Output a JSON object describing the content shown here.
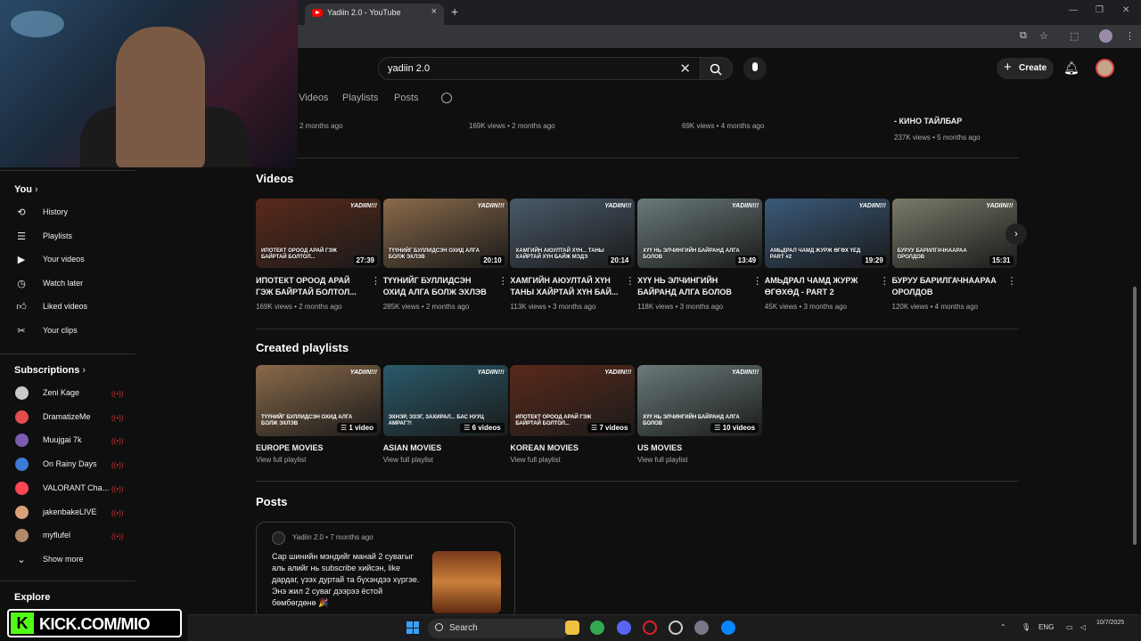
{
  "browser": {
    "tab_title": "Yadiin 2.0 - YouTube",
    "tab_close": "×",
    "new_tab": "+"
  },
  "header": {
    "search_value": "yadiin 2.0",
    "create_label": "Create"
  },
  "channel_tabs": [
    "Videos",
    "Playlists",
    "Posts"
  ],
  "sidebar": {
    "you_label": "You",
    "you_items": [
      {
        "label": "History",
        "icon": "history-icon"
      },
      {
        "label": "Playlists",
        "icon": "playlists-icon"
      },
      {
        "label": "Your videos",
        "icon": "your-videos-icon"
      },
      {
        "label": "Watch later",
        "icon": "watch-later-icon"
      },
      {
        "label": "Liked videos",
        "icon": "thumbs-up-icon"
      },
      {
        "label": "Your clips",
        "icon": "scissors-icon"
      }
    ],
    "subs_label": "Subscriptions",
    "subscriptions": [
      {
        "label": "Zeni Kage",
        "color": "#c9c9c9"
      },
      {
        "label": "DramatizeMe",
        "color": "#e44d4d"
      },
      {
        "label": "Muujgai 7k",
        "color": "#7a5cb0"
      },
      {
        "label": "On Rainy Days",
        "color": "#3a7bd5"
      },
      {
        "label": "VALORANT Cha...",
        "color": "#ff4655"
      },
      {
        "label": "jakenbakeLIVE",
        "color": "#d9a07a"
      },
      {
        "label": "myflufel",
        "color": "#b08b6a"
      }
    ],
    "show_more": "Show more",
    "explore_label": "Explore"
  },
  "top_row": {
    "items": [
      {
        "meta": "2 months ago"
      },
      {
        "meta": "169K views • 2 months ago"
      },
      {
        "meta": "69K views • 4 months ago"
      },
      {
        "title": "- КИНО ТАЙЛБАР",
        "meta": "237K views • 5 months ago"
      }
    ]
  },
  "videos_section": {
    "title": "Videos",
    "videos": [
      {
        "title": "ИПОТЕКТ ОРООД АРАЙ ГЭЖ БАЙРТАЙ БОЛТОЛ...",
        "meta": "169K views • 2 months ago",
        "duration": "27:39",
        "thumb_caption": "ИПОТЕКТ ОРООД АРАЙ ГЭЖ БАЙРТАЙ БОЛТОЛ...",
        "color": "#5a2a1a"
      },
      {
        "title": "ТҮҮНИЙГ БУЛЛИДСЭН ОХИД АЛГА БОЛЖ ЭХЛЭВ",
        "meta": "285K views • 2 months ago",
        "duration": "20:10",
        "thumb_caption": "ТҮҮНИЙГ БУЛЛИДСЭН ОХИД АЛГА БОЛЖ ЭХЛЭВ",
        "color": "#8a6a4a"
      },
      {
        "title": "ХАМГИЙН АЮУЛТАЙ ХҮН ТАНЫ ХАЙРТАЙ ХҮН БАЙ...",
        "meta": "113K views • 3 months ago",
        "duration": "20:14",
        "thumb_caption": "ХАМГИЙН АЮУЛТАЙ ХҮН... ТАНЫ ХАЙРТАЙ ХҮН БАЙЖ МЭДЭ",
        "color": "#4a5a6a"
      },
      {
        "title": "ХҮҮ НЬ ЭЛЧИНГИЙН БАЙРАНД АЛГА БОЛОВ",
        "meta": "118K views • 3 months ago",
        "duration": "13:49",
        "thumb_caption": "ХҮҮ НЬ ЭЛЧИНГИЙН БАЙРАНД АЛГА БОЛОВ",
        "color": "#6a7a7a"
      },
      {
        "title": "АМЬДРАЛ ЧАМД ЖУРЖ ӨГӨХӨД - PART 2",
        "meta": "45K views • 3 months ago",
        "duration": "19:29",
        "thumb_caption": "АМЬДРАЛ ЧАМД ЖУРЖ ӨГӨХ ҮЕД PART #2",
        "color": "#3a5a7a"
      },
      {
        "title": "БУРУУ БАРИЛГАЧНААРАА ОРОЛДОВ",
        "meta": "120K views • 4 months ago",
        "duration": "15:31",
        "thumb_caption": "БУРУУ БАРИЛГАЧНААРАА ОРОЛДОВ",
        "color": "#7a7a6a"
      }
    ]
  },
  "playlists_section": {
    "title": "Created playlists",
    "playlists": [
      {
        "title": "EUROPE MOVIES",
        "count": "1 video",
        "link": "View full playlist",
        "thumb_caption": "ТҮҮНИЙГ БУЛЛИДСЭН ОХИД АЛГА БОЛЖ ЭХЛЭВ",
        "color": "#8a6a4a"
      },
      {
        "title": "ASIAN MOVIES",
        "count": "6 videos",
        "link": "View full playlist",
        "thumb_caption": "ЭХНЭР, ЭЗЭГ, ЗАХИРАЛ... БАС НУУЦ АМРАГ?!",
        "color": "#2a5a6a"
      },
      {
        "title": "KOREAN MOVIES",
        "count": "7 videos",
        "link": "View full playlist",
        "thumb_caption": "ИПОТЕКТ ОРООД АРАЙ ГЭЖ БАЙРТАЙ БОЛТОЛ...",
        "color": "#5a2a1a"
      },
      {
        "title": "US MOVIES",
        "count": "10 videos",
        "link": "View full playlist",
        "thumb_caption": "ХҮҮ НЬ ЭЛЧИНГИЙН БАЙРАНД АЛГА БОЛОВ",
        "color": "#6a7a7a"
      }
    ]
  },
  "posts_section": {
    "title": "Posts",
    "author_line": "Yadiin 2.0 • 7 months ago",
    "text": "Сар шинийн мэндийг манай 2 сувагыг аль алийг нь subscribe хийсэн, like дардаг, үзэх дуртай та бүхэндээ хүргэе. Энэ жил 2 суваг дээрээ ёстой бөмбөгдөнө 🎉"
  },
  "thumb_brand": "YADIIN!!!",
  "overlay": {
    "kick_letter": "K",
    "kick_text": "KICK.COM/MIO"
  },
  "taskbar": {
    "search_label": "Search",
    "lang": "ENG",
    "time": "",
    "date": "10/7/2025"
  },
  "colors": {
    "accent_red": "#ff0000",
    "kick_green": "#53fc18",
    "background": "#0f0f0f"
  }
}
